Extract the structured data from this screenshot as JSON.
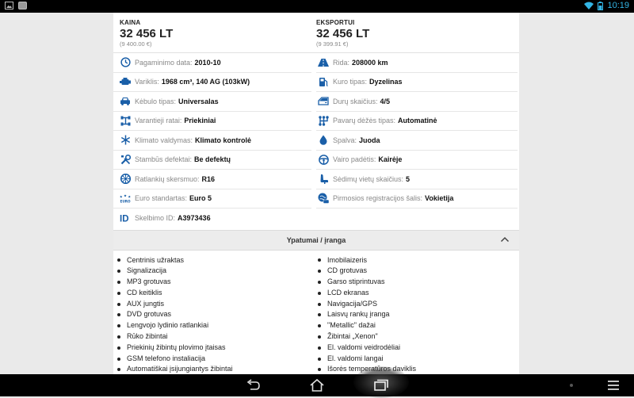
{
  "status_bar": {
    "time": "10:19"
  },
  "prices": [
    {
      "label": "KAINA",
      "value": "32 456 LT",
      "sub": "(9 400.00 €)"
    },
    {
      "label": "EKSPORTUI",
      "value": "32 456 LT",
      "sub": "(9 399.91 €)"
    }
  ],
  "specs_left": [
    {
      "icon": "clock-icon",
      "label": "Pagaminimo data:",
      "value": "2010-10"
    },
    {
      "icon": "engine-icon",
      "label": "Variklis:",
      "value": "1968 cm³, 140 AG (103kW)"
    },
    {
      "icon": "car-body-icon",
      "label": "Kėbulo tipas:",
      "value": "Universalas"
    },
    {
      "icon": "drive-wheels-icon",
      "label": "Varantieji ratai:",
      "value": "Priekiniai"
    },
    {
      "icon": "climate-icon",
      "label": "Klimato valdymas:",
      "value": "Klimato kontrolė"
    },
    {
      "icon": "tools-icon",
      "label": "Stambūs defektai:",
      "value": "Be defektų"
    },
    {
      "icon": "rim-icon",
      "label": "Ratlankių skersmuo:",
      "value": "R16"
    },
    {
      "icon": "euro-standard-icon",
      "label": "Euro standartas:",
      "value": "Euro 5"
    },
    {
      "icon": "id-icon",
      "label": "Skelbimo ID:",
      "value": "A3973436"
    }
  ],
  "specs_right": [
    {
      "icon": "road-icon",
      "label": "Rida:",
      "value": "208000 km"
    },
    {
      "icon": "fuel-pump-icon",
      "label": "Kuro tipas:",
      "value": "Dyzelinas"
    },
    {
      "icon": "door-icon",
      "label": "Durų skaičius:",
      "value": "4/5"
    },
    {
      "icon": "gearbox-icon",
      "label": "Pavarų dėžės tipas:",
      "value": "Automatinė"
    },
    {
      "icon": "paint-drop-icon",
      "label": "Spalva:",
      "value": "Juoda"
    },
    {
      "icon": "steering-wheel-icon",
      "label": "Vairo padėtis:",
      "value": "Kairėje"
    },
    {
      "icon": "seat-icon",
      "label": "Sėdimų vietų skaičius:",
      "value": "5"
    },
    {
      "icon": "first-registration-icon",
      "label": "Pirmosios registracijos šalis:",
      "value": "Vokietija"
    }
  ],
  "features_section": {
    "title": "Ypatumai / įranga",
    "left": [
      "Centrinis užraktas",
      "Signalizacija",
      "MP3 grotuvas",
      "CD keitiklis",
      "AUX jungtis",
      "DVD grotuvas",
      "Lengvojo lydinio ratlankiai",
      "Rūko žibintai",
      "Priekinių žibintų plovimo įtaisas",
      "GSM telefono instaliacija",
      "Automatiškai įsijungiantys žibintai"
    ],
    "right": [
      "Imobilaizeris",
      "CD grotuvas",
      "Garso stiprintuvas",
      "LCD ekranas",
      "Navigacija/GPS",
      "Laisvų rankų įranga",
      "\"Metallic\" dažai",
      "Žibintai „Xenon\"",
      "El. valdomi veidrodėliai",
      "El. valdomi langai",
      "Išorės temperatūros daviklis"
    ]
  },
  "colors": {
    "accent": "#1a5fa8",
    "status_blue": "#33b5e5"
  }
}
